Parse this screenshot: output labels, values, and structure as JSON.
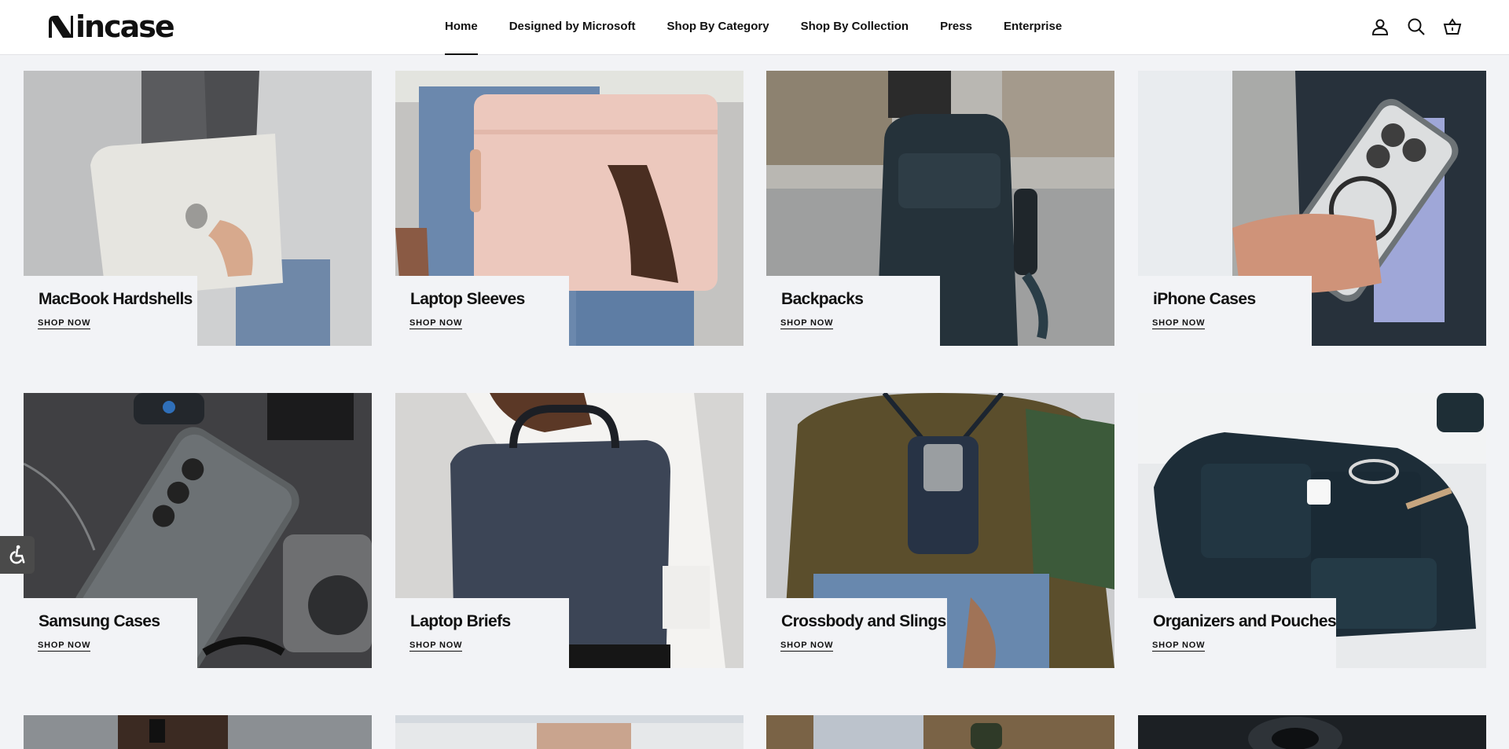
{
  "brand": {
    "name": "incase"
  },
  "nav": {
    "items": [
      {
        "label": "Home",
        "active": true
      },
      {
        "label": "Designed by Microsoft"
      },
      {
        "label": "Shop By Category"
      },
      {
        "label": "Shop By Collection"
      },
      {
        "label": "Press"
      },
      {
        "label": "Enterprise"
      }
    ]
  },
  "header_icons": [
    "account-icon",
    "search-icon",
    "cart-icon"
  ],
  "categories": [
    {
      "title": "MacBook Hardshells",
      "cta": "SHOP NOW"
    },
    {
      "title": "Laptop Sleeves",
      "cta": "SHOP NOW"
    },
    {
      "title": "Backpacks",
      "cta": "SHOP NOW"
    },
    {
      "title": "iPhone Cases",
      "cta": "SHOP NOW"
    },
    {
      "title": "Samsung Cases",
      "cta": "SHOP NOW"
    },
    {
      "title": "Laptop Briefs",
      "cta": "SHOP NOW"
    },
    {
      "title": "Crossbody and Slings",
      "cta": "SHOP NOW"
    },
    {
      "title": "Organizers and Pouches",
      "cta": "SHOP NOW"
    }
  ],
  "accessibility": {
    "icon": "accessibility-icon"
  }
}
